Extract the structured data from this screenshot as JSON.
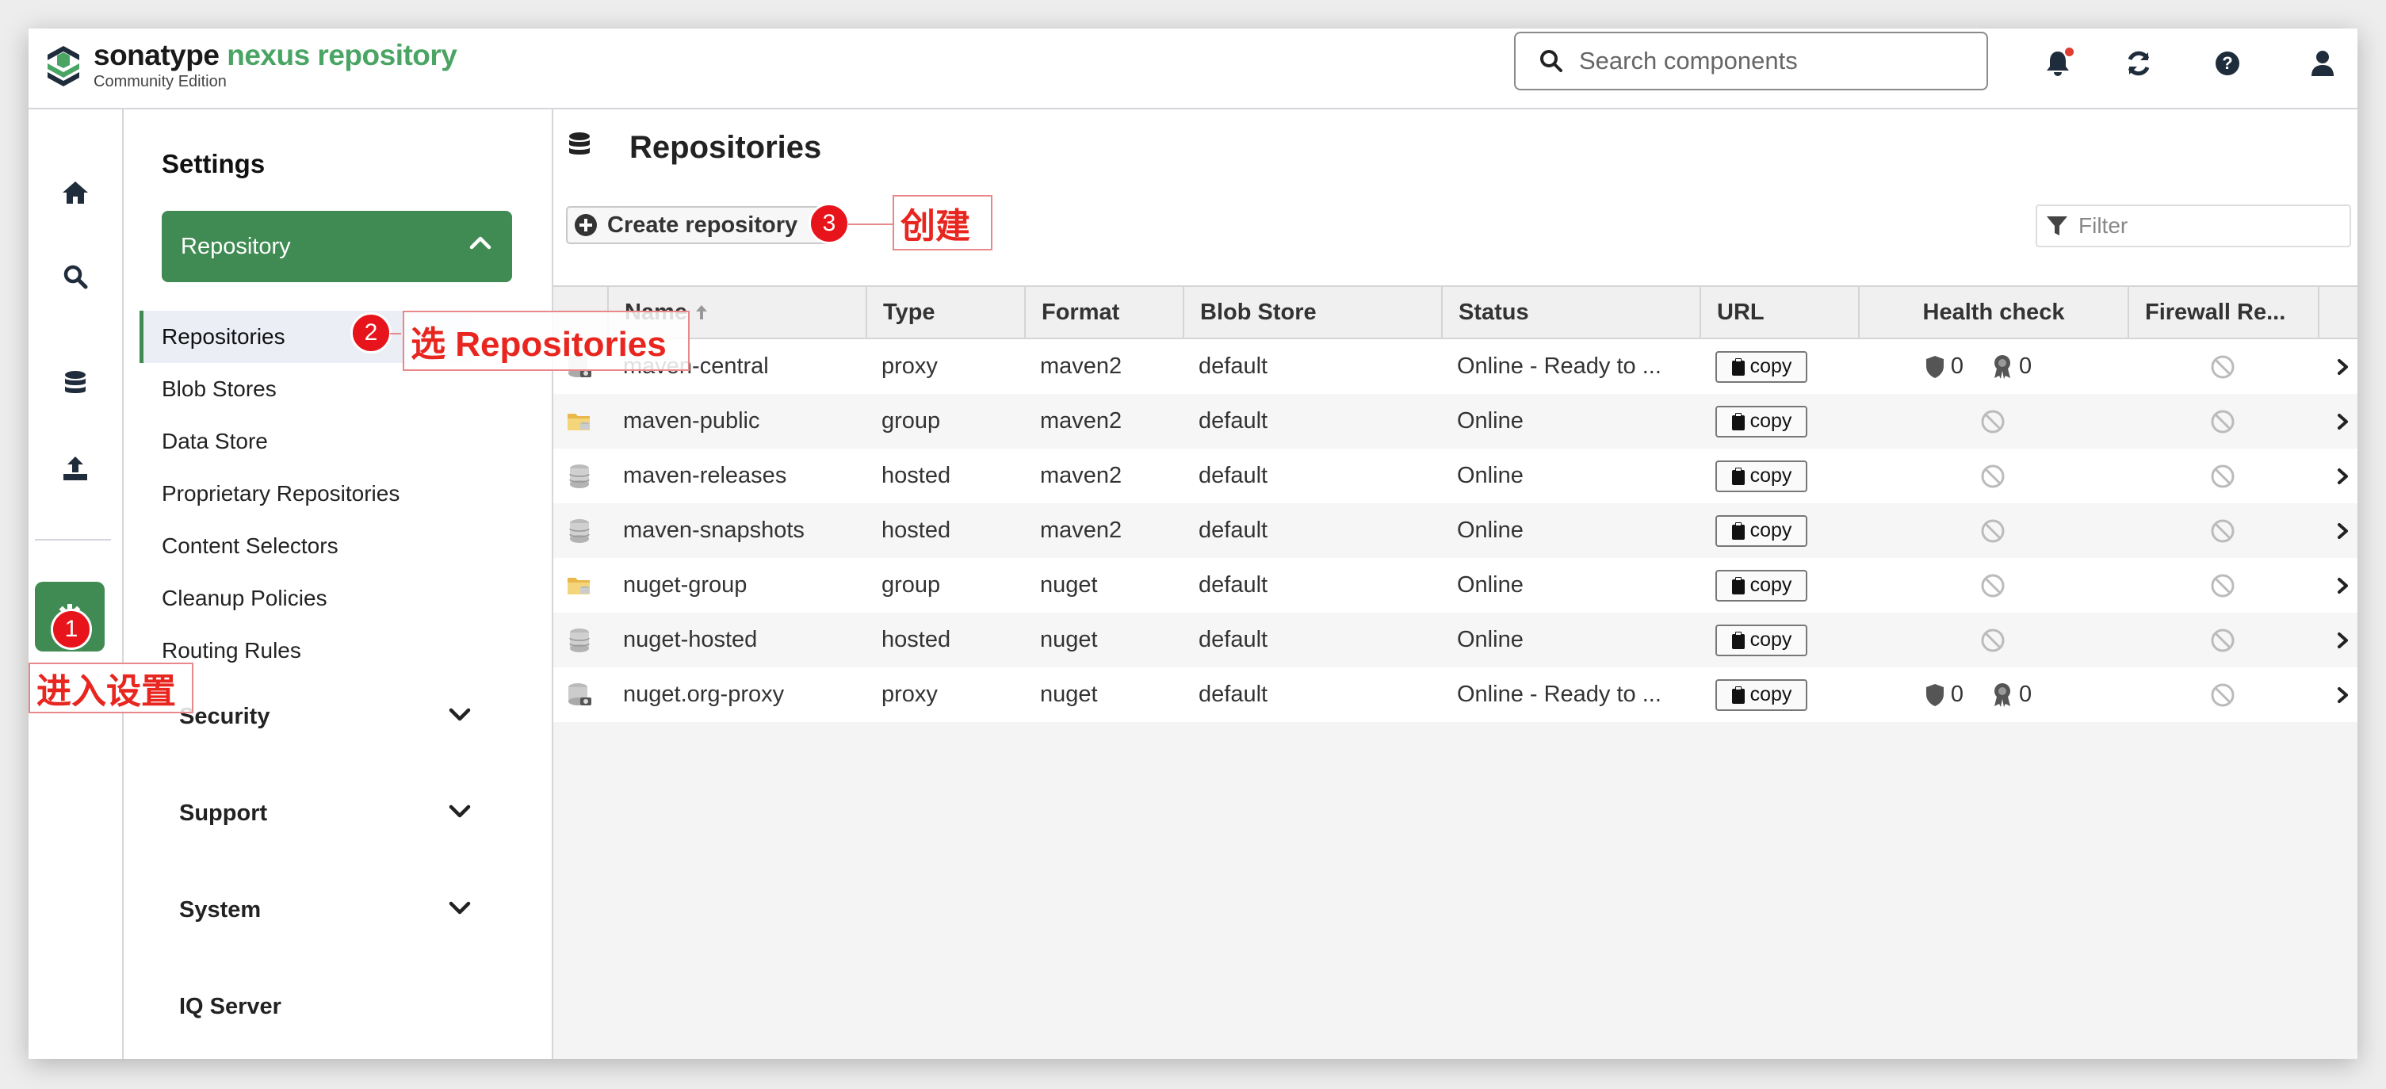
{
  "header": {
    "logo_brand": "sonatype",
    "logo_product": "nexus repository",
    "logo_edition": "Community Edition",
    "search_placeholder": "Search components"
  },
  "rail_icons": [
    "home-icon",
    "search-icon",
    "database-icon",
    "upload-icon",
    "gear-icon"
  ],
  "sidebar": {
    "title": "Settings",
    "repository_label": "Repository",
    "repository_items": [
      "Repositories",
      "Blob Stores",
      "Data Store",
      "Proprietary Repositories",
      "Content Selectors",
      "Cleanup Policies",
      "Routing Rules"
    ],
    "sections": [
      "Security",
      "Support",
      "System",
      "IQ Server"
    ]
  },
  "main": {
    "title": "Repositories",
    "create_label": "Create repository",
    "filter_placeholder": "Filter",
    "columns": [
      "Name",
      "Type",
      "Format",
      "Blob Store",
      "Status",
      "URL",
      "Health check",
      "Firewall Re..."
    ],
    "rows": [
      {
        "name": "maven-central",
        "type": "proxy",
        "format": "maven2",
        "blob": "default",
        "status": "Online - Ready to ...",
        "url": "copy",
        "hc1": "0",
        "hc2": "0",
        "icon": "proxy-icon"
      },
      {
        "name": "maven-public",
        "type": "group",
        "format": "maven2",
        "blob": "default",
        "status": "Online",
        "url": "copy",
        "icon": "group-folder-icon"
      },
      {
        "name": "maven-releases",
        "type": "hosted",
        "format": "maven2",
        "blob": "default",
        "status": "Online",
        "url": "copy",
        "icon": "hosted-db-icon"
      },
      {
        "name": "maven-snapshots",
        "type": "hosted",
        "format": "maven2",
        "blob": "default",
        "status": "Online",
        "url": "copy",
        "icon": "hosted-db-icon"
      },
      {
        "name": "nuget-group",
        "type": "group",
        "format": "nuget",
        "blob": "default",
        "status": "Online",
        "url": "copy",
        "icon": "group-folder-icon"
      },
      {
        "name": "nuget-hosted",
        "type": "hosted",
        "format": "nuget",
        "blob": "default",
        "status": "Online",
        "url": "copy",
        "icon": "hosted-db-icon"
      },
      {
        "name": "nuget.org-proxy",
        "type": "proxy",
        "format": "nuget",
        "blob": "default",
        "status": "Online - Ready to ...",
        "url": "copy",
        "hc1": "0",
        "hc2": "0",
        "icon": "proxy-icon"
      }
    ]
  },
  "annotations": {
    "step1_num": "1",
    "step1_text": "进入设置",
    "step2_num": "2",
    "step2_text": "选 Repositories",
    "step3_num": "3",
    "step3_text": "创建"
  },
  "colors": {
    "brand_green": "#3f8b53",
    "logo_green": "#4aa564",
    "annotation_red": "#e8141b"
  }
}
